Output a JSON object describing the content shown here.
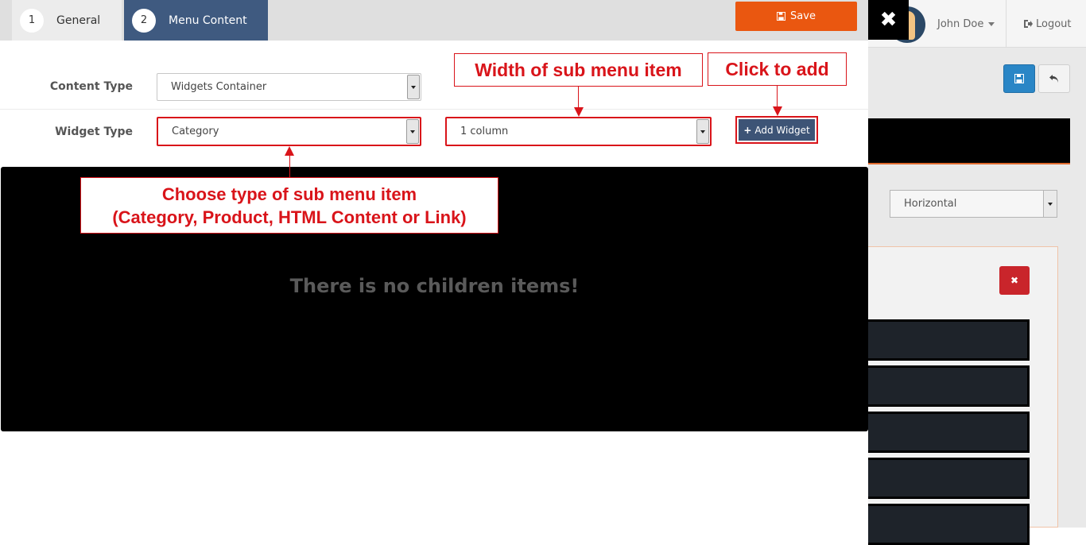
{
  "wizard": {
    "steps": [
      {
        "number": "1",
        "label": "General"
      },
      {
        "number": "2",
        "label": "Menu Content"
      }
    ],
    "save_label": "Save"
  },
  "form": {
    "content_type_label": "Content Type",
    "content_type_value": "Widgets Container",
    "widget_type_label": "Widget Type",
    "widget_type_value": "Category",
    "width_value": "1 column",
    "add_widget_label": "Add Widget"
  },
  "children": {
    "empty_message": "There is no children items!"
  },
  "annotations": {
    "width_note": "Width of sub menu item",
    "add_note": "Click to add",
    "type_note_line1": "Choose type of sub menu item",
    "type_note_line2": "(Category, Product, HTML Content or Link)"
  },
  "background_page": {
    "user_name": "John Doe",
    "logout_label": "Logout",
    "orientation_value": "Horizontal"
  },
  "colors": {
    "accent_save": "#ea5710",
    "active_tab": "#3f5a80",
    "annotation_red": "#d9141a",
    "delete_red": "#c9252b"
  }
}
